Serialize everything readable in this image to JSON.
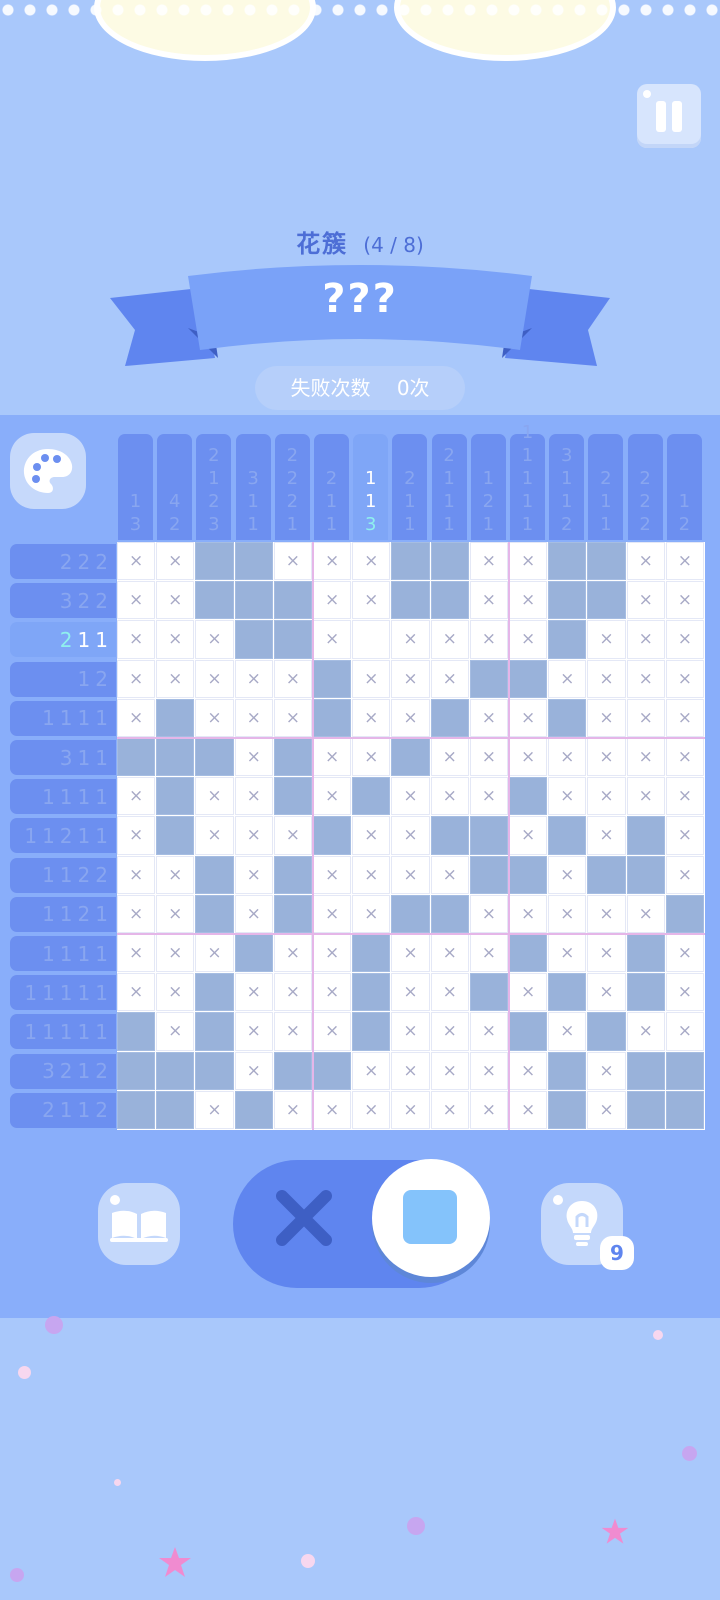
{
  "header": {
    "category": "花簇",
    "progress": "(4 / 8)",
    "puzzle_name": "???",
    "fail_label": "失败次数",
    "fail_count": "0次"
  },
  "tools": {
    "hint_count": "9"
  },
  "icons": {
    "pause": "pause-icon",
    "palette": "palette-icon",
    "book": "book-icon",
    "hint": "lightbulb-icon",
    "cross_mode": "cross-icon",
    "fill_mode": "fill-square-icon"
  },
  "colors": {
    "accent": "#5f85ef",
    "filled_cell": "#99b2da",
    "clue_bg": "#6c8ff0",
    "active_clue_bg": "#7fa6f7",
    "highlight": "#8ff0ee"
  },
  "puzzle": {
    "size": 15,
    "active_column": 6,
    "active_row": 2,
    "column_clues": [
      [
        "1",
        "3"
      ],
      [
        "4",
        "2"
      ],
      [
        "2",
        "1",
        "2",
        "3"
      ],
      [
        "3",
        "1",
        "1"
      ],
      [
        "2",
        "2",
        "2",
        "1"
      ],
      [
        "2",
        "1",
        "1"
      ],
      [
        "1",
        "1",
        "3"
      ],
      [
        "2",
        "1",
        "1"
      ],
      [
        "2",
        "1",
        "1",
        "1"
      ],
      [
        "1",
        "2",
        "1"
      ],
      [
        "1",
        "1",
        "1",
        "1",
        "1"
      ],
      [
        "3",
        "1",
        "1",
        "2"
      ],
      [
        "2",
        "1",
        "1"
      ],
      [
        "2",
        "2",
        "2"
      ],
      [
        "1",
        "2"
      ]
    ],
    "row_clues": [
      [
        "2",
        "2",
        "2"
      ],
      [
        "3",
        "2",
        "2"
      ],
      [
        "2",
        "1",
        "1"
      ],
      [
        "1",
        "2"
      ],
      [
        "1",
        "1",
        "1",
        "1"
      ],
      [
        "3",
        "1",
        "1"
      ],
      [
        "1",
        "1",
        "1",
        "1"
      ],
      [
        "1",
        "1",
        "2",
        "1",
        "1"
      ],
      [
        "1",
        "1",
        "2",
        "2"
      ],
      [
        "1",
        "1",
        "2",
        "1"
      ],
      [
        "1",
        "1",
        "1",
        "1"
      ],
      [
        "1",
        "1",
        "1",
        "1",
        "1"
      ],
      [
        "1",
        "1",
        "1",
        "1",
        "1"
      ],
      [
        "3",
        "2",
        "1",
        "2"
      ],
      [
        "2",
        "1",
        "1",
        "2"
      ]
    ],
    "grid": [
      "XXFFXXXFFXXFFXX",
      "XXFFFXXFFXXFFXX",
      "XXXFFX.XXXXFXXX",
      "XXXXXFXXXFFXXXX",
      "XFXXXFXXFXXFXXX",
      "FFFXFXXFXXXXXXX",
      "XFXXFXFXXXFXXXX",
      "XFXXXFXXFFXFXFX",
      "XXFXFXXXXFFXFFX",
      "XXFXFXXFFXXXXXF",
      "XXXFXXFXXXFXXFX",
      "XXFXXXFXXFXFXFX",
      "FXFXXXFXXXFXFXX",
      "FFFXFFXXXXXFXFF",
      "FFXFXXXXXXXFXFF"
    ]
  }
}
